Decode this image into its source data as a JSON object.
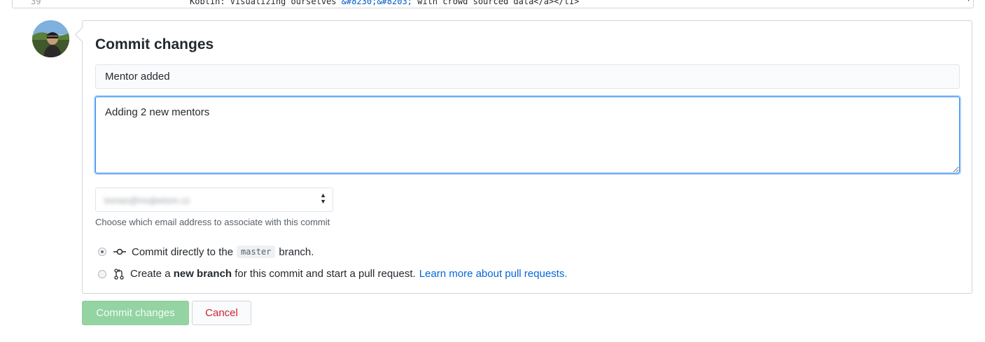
{
  "code_preview": {
    "line_number": "39",
    "code_text_before": "Koblin: Visualizing ourselves ",
    "code_entity": "&#8230;&#8203;",
    "code_text_after": " with crowd sourced data</a></li>"
  },
  "commit_form": {
    "title": "Commit changes",
    "summary_value": "Mentor added",
    "description_value": "Adding 2 new mentors",
    "email_select_value": "tomas@mojbetom.cz",
    "email_note": "Choose which email address to associate with this commit",
    "option_direct": {
      "prefix": "Commit directly to the",
      "branch": "master",
      "suffix": "branch."
    },
    "option_new_branch": {
      "prefix": "Create a",
      "bold": "new branch",
      "suffix": "for this commit and start a pull request.",
      "link": "Learn more about pull requests."
    }
  },
  "buttons": {
    "commit_label": "Commit changes",
    "cancel_label": "Cancel"
  },
  "colors": {
    "commit_button_bg": "#94d3a2",
    "cancel_text": "#cb2431",
    "link": "#0366d6",
    "focus_border": "#2188ff"
  }
}
